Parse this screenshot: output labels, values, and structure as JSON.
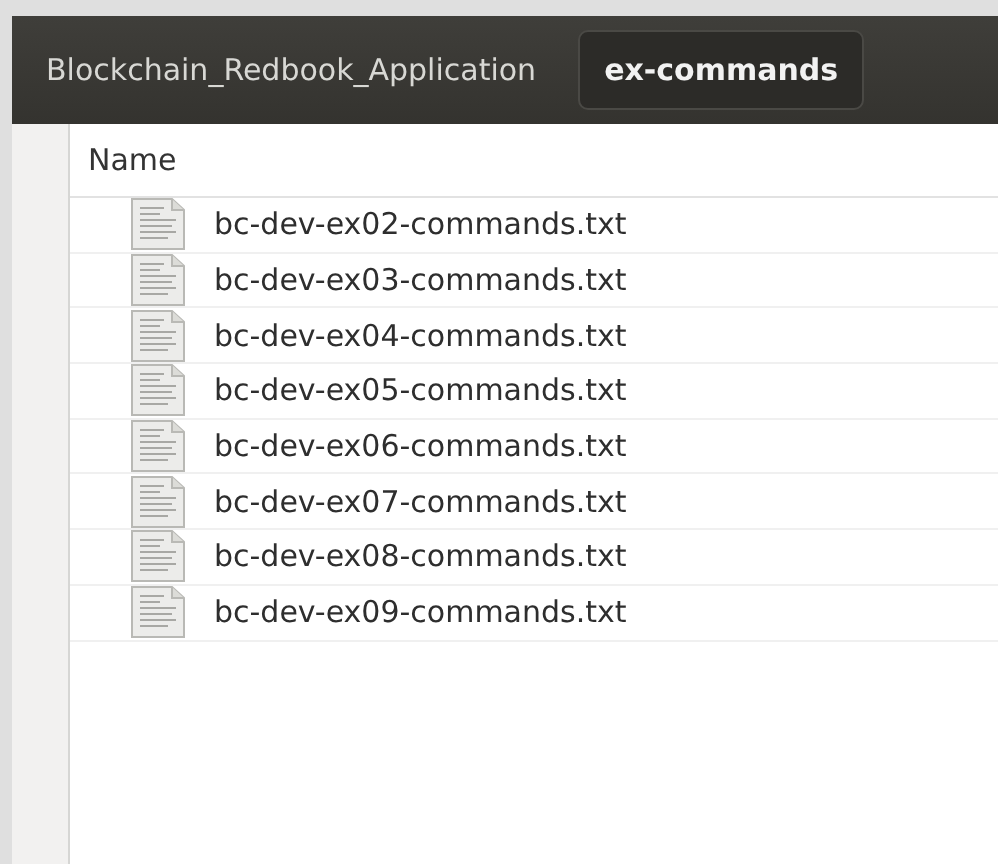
{
  "path_bar": {
    "crumbs": [
      {
        "label": "Blockchain_Redbook_Application",
        "selected": false
      },
      {
        "label": "ex-commands",
        "selected": true
      }
    ]
  },
  "file_list": {
    "columns": [
      "Name"
    ],
    "rows": [
      {
        "name": "bc-dev-ex02-commands.txt"
      },
      {
        "name": "bc-dev-ex03-commands.txt"
      },
      {
        "name": "bc-dev-ex04-commands.txt"
      },
      {
        "name": "bc-dev-ex05-commands.txt"
      },
      {
        "name": "bc-dev-ex06-commands.txt"
      },
      {
        "name": "bc-dev-ex07-commands.txt"
      },
      {
        "name": "bc-dev-ex08-commands.txt"
      },
      {
        "name": "bc-dev-ex09-commands.txt"
      }
    ]
  }
}
